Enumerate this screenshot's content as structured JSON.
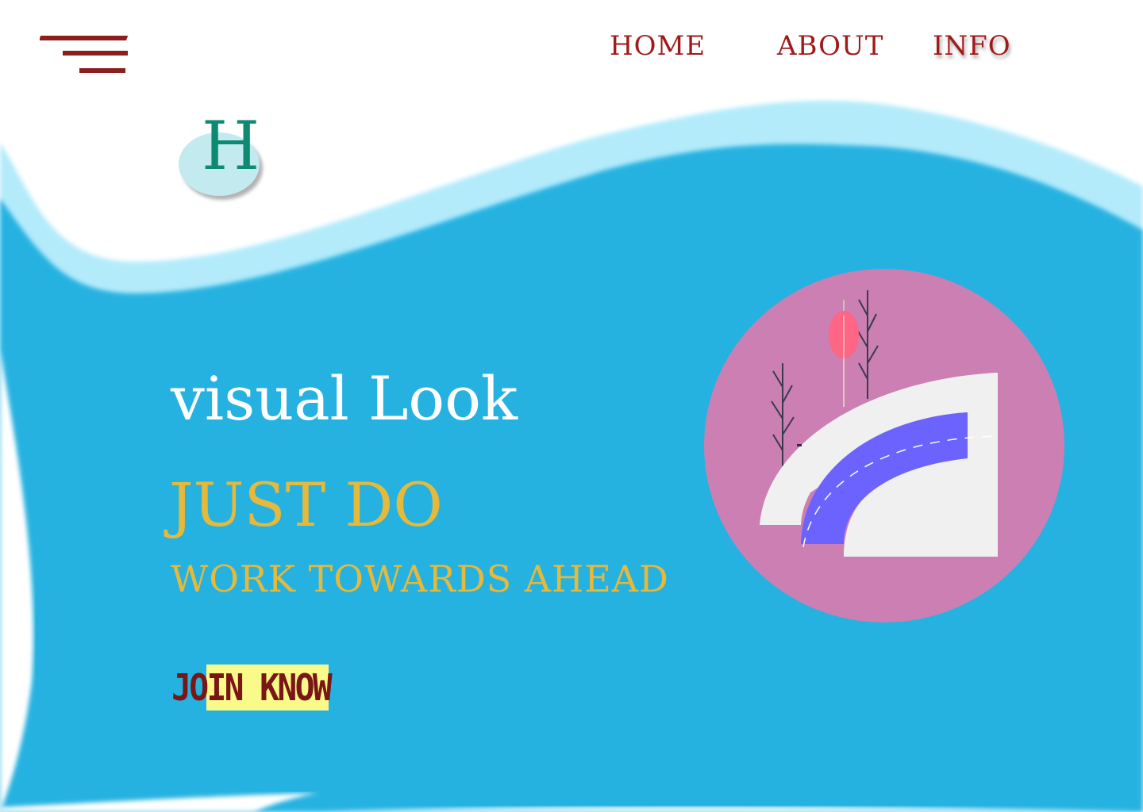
{
  "nav": {
    "items": [
      {
        "label": "HOME"
      },
      {
        "label": "ABOUT"
      },
      {
        "label": "INFO"
      }
    ]
  },
  "logo": {
    "letter": "H"
  },
  "hero": {
    "title": "visual Look",
    "subtitle": "JUST DO",
    "tagline": "WORK TOWARDS AHEAD"
  },
  "cta": {
    "label": "JOIN KNOW"
  },
  "colors": {
    "background_blue": "#27b2e1",
    "wave_light_blue": "#b4ebfb",
    "nav_text": "#a11a1a",
    "hero_title": "#ffffff",
    "hero_accent": "#e6b93b",
    "cta_text": "#7a1616",
    "cta_highlight": "#fafa8a",
    "logo_letter": "#0e8a72",
    "logo_circle": "#c3eaef",
    "illustration_circle": "#cb7fb3",
    "road": "#6c63ff"
  },
  "icons": {
    "menu": "hamburger-menu-icon",
    "illustration": "road-trees-illustration"
  }
}
